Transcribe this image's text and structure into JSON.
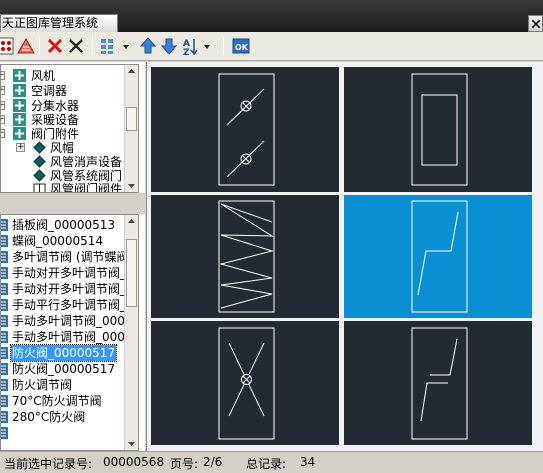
{
  "app": {
    "title": "天正图库管理系统"
  },
  "toolbar": {
    "buttons": [
      "new-library-icon",
      "open-library-icon",
      "delete-icon",
      "cancel-icon",
      "view-mode-icon",
      "move-up-icon",
      "move-down-icon",
      "sort-icon",
      "ok-icon"
    ],
    "ok_label": "OK"
  },
  "tree": {
    "items": [
      {
        "label": "风机"
      },
      {
        "label": "空调器"
      },
      {
        "label": "分集水器"
      },
      {
        "label": "采暖设备"
      },
      {
        "label": "阀门附件"
      },
      {
        "label": "风帽"
      },
      {
        "label": "风管消声设备"
      },
      {
        "label": "风管系统阀门"
      },
      {
        "label": "风管阀门阀件"
      }
    ]
  },
  "list": {
    "items": [
      {
        "label": "插板阀_00000513"
      },
      {
        "label": "蝶阀_00000514"
      },
      {
        "label": "多叶调节阀 (调节蝶阀"
      },
      {
        "label": "手动对开多叶调节阀_"
      },
      {
        "label": "手动对开多叶调节阀_"
      },
      {
        "label": "手动平行多叶调节阀_"
      },
      {
        "label": "手动多叶调节阀_0000"
      },
      {
        "label": "手动多叶调节阀_0000"
      },
      {
        "label": "防火阀_00000517",
        "selected": true
      },
      {
        "label": "防火阀_00000517"
      },
      {
        "label": "防火调节阀"
      },
      {
        "label": "70°C防火调节阀"
      },
      {
        "label": "280°C防火阀"
      },
      {
        "label": ""
      }
    ]
  },
  "colors": {
    "cell_bg": "#242a33",
    "cell_selected": "#0a8fd4",
    "selection": "#3399ff"
  },
  "status": {
    "current_label": "当前选中记录号:",
    "current_value": "00000568",
    "page_label": "页号:",
    "page_value": "2/6",
    "total_label": "总记录:",
    "total_value": "34"
  }
}
